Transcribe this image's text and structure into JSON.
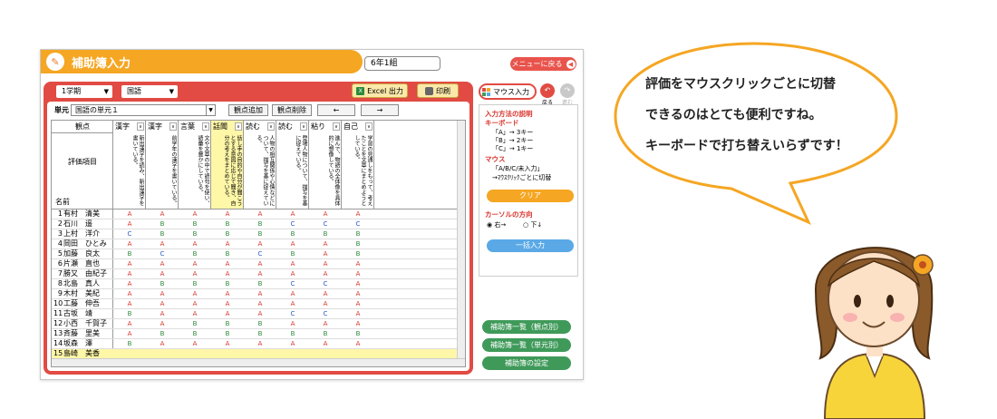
{
  "window": {
    "title": "補助簿入力",
    "class_name": "6年1組",
    "menu_button": "メニューに戻る"
  },
  "toolbar": {
    "semester": "1学期",
    "subject": "国語",
    "excel_label": "Excel 出力",
    "print_label": "印刷"
  },
  "unit_row": {
    "label": "単元",
    "unit_value": "国語の単元１",
    "add_point_label": "観点追加",
    "del_point_label": "観点削除",
    "prev_label": "←",
    "next_label": "→"
  },
  "grid": {
    "kanten_label": "観点",
    "hyouka_label": "評価項目",
    "name_label": "名前",
    "columns": [
      {
        "head": "漢字",
        "item": "新出漢字を読み、新出漢字を書いている。"
      },
      {
        "head": "漢字",
        "item": "前学年の漢字を書いている。"
      },
      {
        "head": "言葉",
        "item": "文や文章の中で語句を使い、語彙を豊かにしている。"
      },
      {
        "head": "話聞",
        "item": "話し手の目的や自分が聞こうとする意図に応じて聞き、自分の考えをまとめている。"
      },
      {
        "head": "読む",
        "item": "人物の相互関係や心情などについて、描写を基に捉えている。"
      },
      {
        "head": "読む",
        "item": "登場人物について、描写を基に捉えている。"
      },
      {
        "head": "粘り",
        "item": "進んで、物語の全体像を具体的に想像している。"
      },
      {
        "head": "自己",
        "item": "学習の見通しをもって、考えたことを文章にまとめようとしている。"
      }
    ],
    "students": [
      {
        "no": "1",
        "name": "有村　清美",
        "grades": [
          "A",
          "A",
          "A",
          "A",
          "A",
          "A",
          "A",
          "A"
        ]
      },
      {
        "no": "2",
        "name": "石川　遥",
        "grades": [
          "A",
          "B",
          "B",
          "B",
          "B",
          "C",
          "C",
          "C"
        ]
      },
      {
        "no": "3",
        "name": "上村　洋介",
        "grades": [
          "C",
          "B",
          "B",
          "B",
          "B",
          "B",
          "B",
          "B"
        ]
      },
      {
        "no": "4",
        "name": "岡田　ひとみ",
        "grades": [
          "A",
          "A",
          "A",
          "A",
          "A",
          "A",
          "A",
          "B"
        ]
      },
      {
        "no": "5",
        "name": "加藤　良太",
        "grades": [
          "B",
          "C",
          "B",
          "B",
          "C",
          "B",
          "A",
          "B"
        ]
      },
      {
        "no": "6",
        "name": "片瀬　直也",
        "grades": [
          "A",
          "A",
          "A",
          "A",
          "A",
          "A",
          "A",
          "A"
        ]
      },
      {
        "no": "7",
        "name": "勝又　由紀子",
        "grades": [
          "A",
          "A",
          "A",
          "A",
          "A",
          "A",
          "A",
          "A"
        ]
      },
      {
        "no": "8",
        "name": "北島　真人",
        "grades": [
          "A",
          "B",
          "B",
          "B",
          "B",
          "C",
          "C",
          "A"
        ]
      },
      {
        "no": "9",
        "name": "木村　美紀",
        "grades": [
          "A",
          "A",
          "A",
          "A",
          "A",
          "A",
          "A",
          "A"
        ]
      },
      {
        "no": "10",
        "name": "工藤　伸吾",
        "grades": [
          "A",
          "A",
          "A",
          "A",
          "A",
          "A",
          "A",
          "A"
        ]
      },
      {
        "no": "11",
        "name": "古坂　靖",
        "grades": [
          "B",
          "A",
          "A",
          "A",
          "A",
          "C",
          "C",
          "A"
        ]
      },
      {
        "no": "12",
        "name": "小西　千賀子",
        "grades": [
          "A",
          "A",
          "B",
          "B",
          "B",
          "A",
          "A",
          "A"
        ]
      },
      {
        "no": "13",
        "name": "斉藤　里美",
        "grades": [
          "A",
          "B",
          "B",
          "B",
          "B",
          "B",
          "B",
          "B"
        ]
      },
      {
        "no": "14",
        "name": "坂森　澤",
        "grades": [
          "B",
          "A",
          "A",
          "A",
          "A",
          "A",
          "A",
          "A"
        ]
      },
      {
        "no": "15",
        "name": "島崎　美香",
        "grades": [
          "",
          "",
          "",
          "",
          "",
          "",
          "",
          ""
        ]
      }
    ]
  },
  "side": {
    "mouse_label": "マウス入力",
    "back_label": "戻る",
    "forward_label": "進む",
    "help_title": "入力方法の説明",
    "keyboard_title": "キーボード",
    "key_a": "「A」→ 3キー",
    "key_b": "「B」→ 2キー",
    "key_c": "「C」→ 1キー",
    "mouse_title": "マウス",
    "mouse_desc1": "「A/B/C/未入力」",
    "mouse_desc2": "→ﾏｳｽｸﾘｯｸごとに切替",
    "clear_label": "クリア",
    "cursor_title": "カーソルの方向",
    "cursor_right": "右→",
    "cursor_down": "下↓",
    "bulk_label": "一括入力",
    "list_by_point": "補助簿一覧（観点別）",
    "list_by_unit": "補助簿一覧（単元別）",
    "settings": "補助簿の設定"
  },
  "speech": {
    "line1": "評価をマウスクリックごとに切替",
    "line2": "できるのはとても便利ですね。",
    "line3": "キーボードで打ち替えいらずです！"
  },
  "colors": {
    "orange": "#f5a623",
    "red": "#e14b43",
    "green": "#3f9a5a",
    "blue": "#5aa9e6",
    "grade_a": "#d9322b",
    "grade_b": "#2f8a3e",
    "grade_c": "#2a58c8"
  }
}
